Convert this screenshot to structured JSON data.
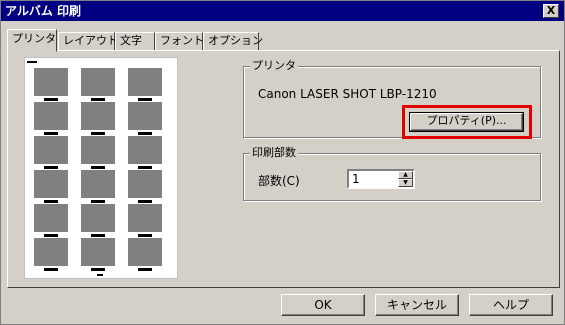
{
  "window": {
    "title": "アルバム 印刷",
    "close_glyph": "X"
  },
  "tabs": [
    {
      "label": "プリンタ",
      "active": true
    },
    {
      "label": "レイアウト",
      "active": false
    },
    {
      "label": "文字",
      "active": false
    },
    {
      "label": "フォント",
      "active": false
    },
    {
      "label": "オプション",
      "active": false
    }
  ],
  "preview": {
    "rows": 6,
    "columns": 3
  },
  "printer_group": {
    "label": "プリンタ",
    "printer_name": "Canon LASER SHOT LBP-1210",
    "properties_button": "プロパティ(P)..."
  },
  "copies_group": {
    "label": "印刷部数",
    "copies_label": "部数(C)",
    "copies_value": "1"
  },
  "buttons": {
    "ok": "OK",
    "cancel": "キャンセル",
    "help": "ヘルプ"
  },
  "colors": {
    "title_bar": "#000080",
    "dialog_face": "#d4d0c8",
    "highlight": "#e00000",
    "thumbnail": "#808080"
  }
}
